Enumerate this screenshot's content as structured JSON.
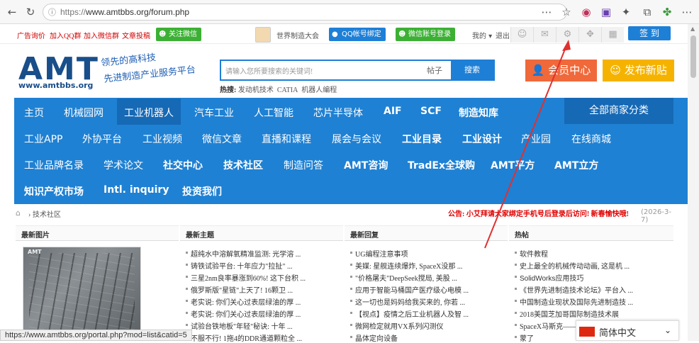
{
  "browser": {
    "url_prefix": "https://",
    "url_rest": "www.amtbbs.org/forum.php"
  },
  "topbar": {
    "links": [
      "广告询价",
      "加入QQ群",
      "加入微信群",
      "文章投稿"
    ],
    "follow_wechat": "关注微信",
    "forum_name": "世界制造大会",
    "qq_bind": "QQ帐号绑定",
    "wechat_login": "微信账号登录",
    "my": "我的",
    "logout": "退出",
    "signin": "签 到"
  },
  "header": {
    "logo_text": "AMT",
    "logo_url": "www.amtbbs.org",
    "slogan_1": "领先的高科技",
    "slogan_2": "先进制造产业服务平台",
    "search_placeholder": "请输入您所要搜索的关键词!",
    "search_type": "帖子",
    "search_button": "搜索",
    "hot_label": "热搜:",
    "hot_terms": [
      "发动机技术",
      "CATIA",
      "机器人编程"
    ],
    "member_center": "会员中心",
    "new_post": "发布新贴"
  },
  "nav": {
    "all_categories": "全部商家分类",
    "row1": [
      "主页",
      "机械园网",
      "工业机器人",
      "汽车工业",
      "人工智能",
      "芯片半导体",
      "AIF",
      "SCF",
      "制造知库"
    ],
    "row2": [
      "工业APP",
      "外协平台",
      "工业视频",
      "微信文章",
      "直播和课程",
      "展会与会议",
      "工业目录",
      "工业设计",
      "产业园",
      "在线商城"
    ],
    "row3": [
      "工业品牌名录",
      "学术论文",
      "社交中心",
      "技术社区",
      "制造问答",
      "AMT咨询",
      "TradEx全球购",
      "AMT平方",
      "AMT立方"
    ],
    "row4": [
      "知识产权市场",
      "Intl. inquiry",
      "投资我们"
    ]
  },
  "breadcrumb": {
    "current": "技术社区",
    "notice": "公告: 小艾拜请大家绑定手机号后登录后访问! 新春愉快哦!",
    "date": "(2026-3-7)"
  },
  "columns": {
    "latest_pics": "最新图片",
    "latest_topics": "最新主题",
    "latest_replies": "最新回复",
    "hot_posts": "热帖",
    "pic_tag": "AMT",
    "topics": [
      "超纯水中溶解氧精准监测: 光学溶 ...",
      "铸铁试验平台: 十年应力\"拉扯\" ...",
      "三星2nm良率暴涨到60%! 这下台积 ...",
      "俄罗斯版\"星链\"上天了! 16颗卫 ...",
      "老实说: 你们关心过表层绿油的厚 ...",
      "老实说: 你们关心过表层绿油的厚 ...",
      "试验台铁地板\"年轻\"秘诀: 十年 ...",
      "不服不行! 1拖4的DDR通道颗粒全 ..."
    ],
    "replies": [
      "UG编程注意事项",
      "美媒: 星舰连续爆炸, SpaceX没那 ...",
      "\"价格屠夫\"DeepSeek搅局, 美股 ...",
      "应用于智能马桶国产医疗级心电模 ...",
      "这一切也是妈妈给我买来的, 你若 ...",
      "【视点】疫情之后工业机器人及智 ...",
      "微网检定就用VX系列闪测仪",
      "晶体定向设备"
    ],
    "hot": [
      "软件教程",
      "史上最全的机械传动动画, 这是机 ...",
      "SolidWorks应用技巧",
      "《世界先进制造技术论坛》平台入 ...",
      "中国制造业现状及国际先进制造技 ...",
      "2018美国芝加哥国际制造技术展",
      "SpaceX马斯克——超级偶像火箭",
      "蒙了"
    ]
  },
  "statusbar": {
    "url": "https://www.amtbbs.org/portal.php?mod=list&catid=5"
  },
  "lang_widget": {
    "label": "简体中文"
  }
}
